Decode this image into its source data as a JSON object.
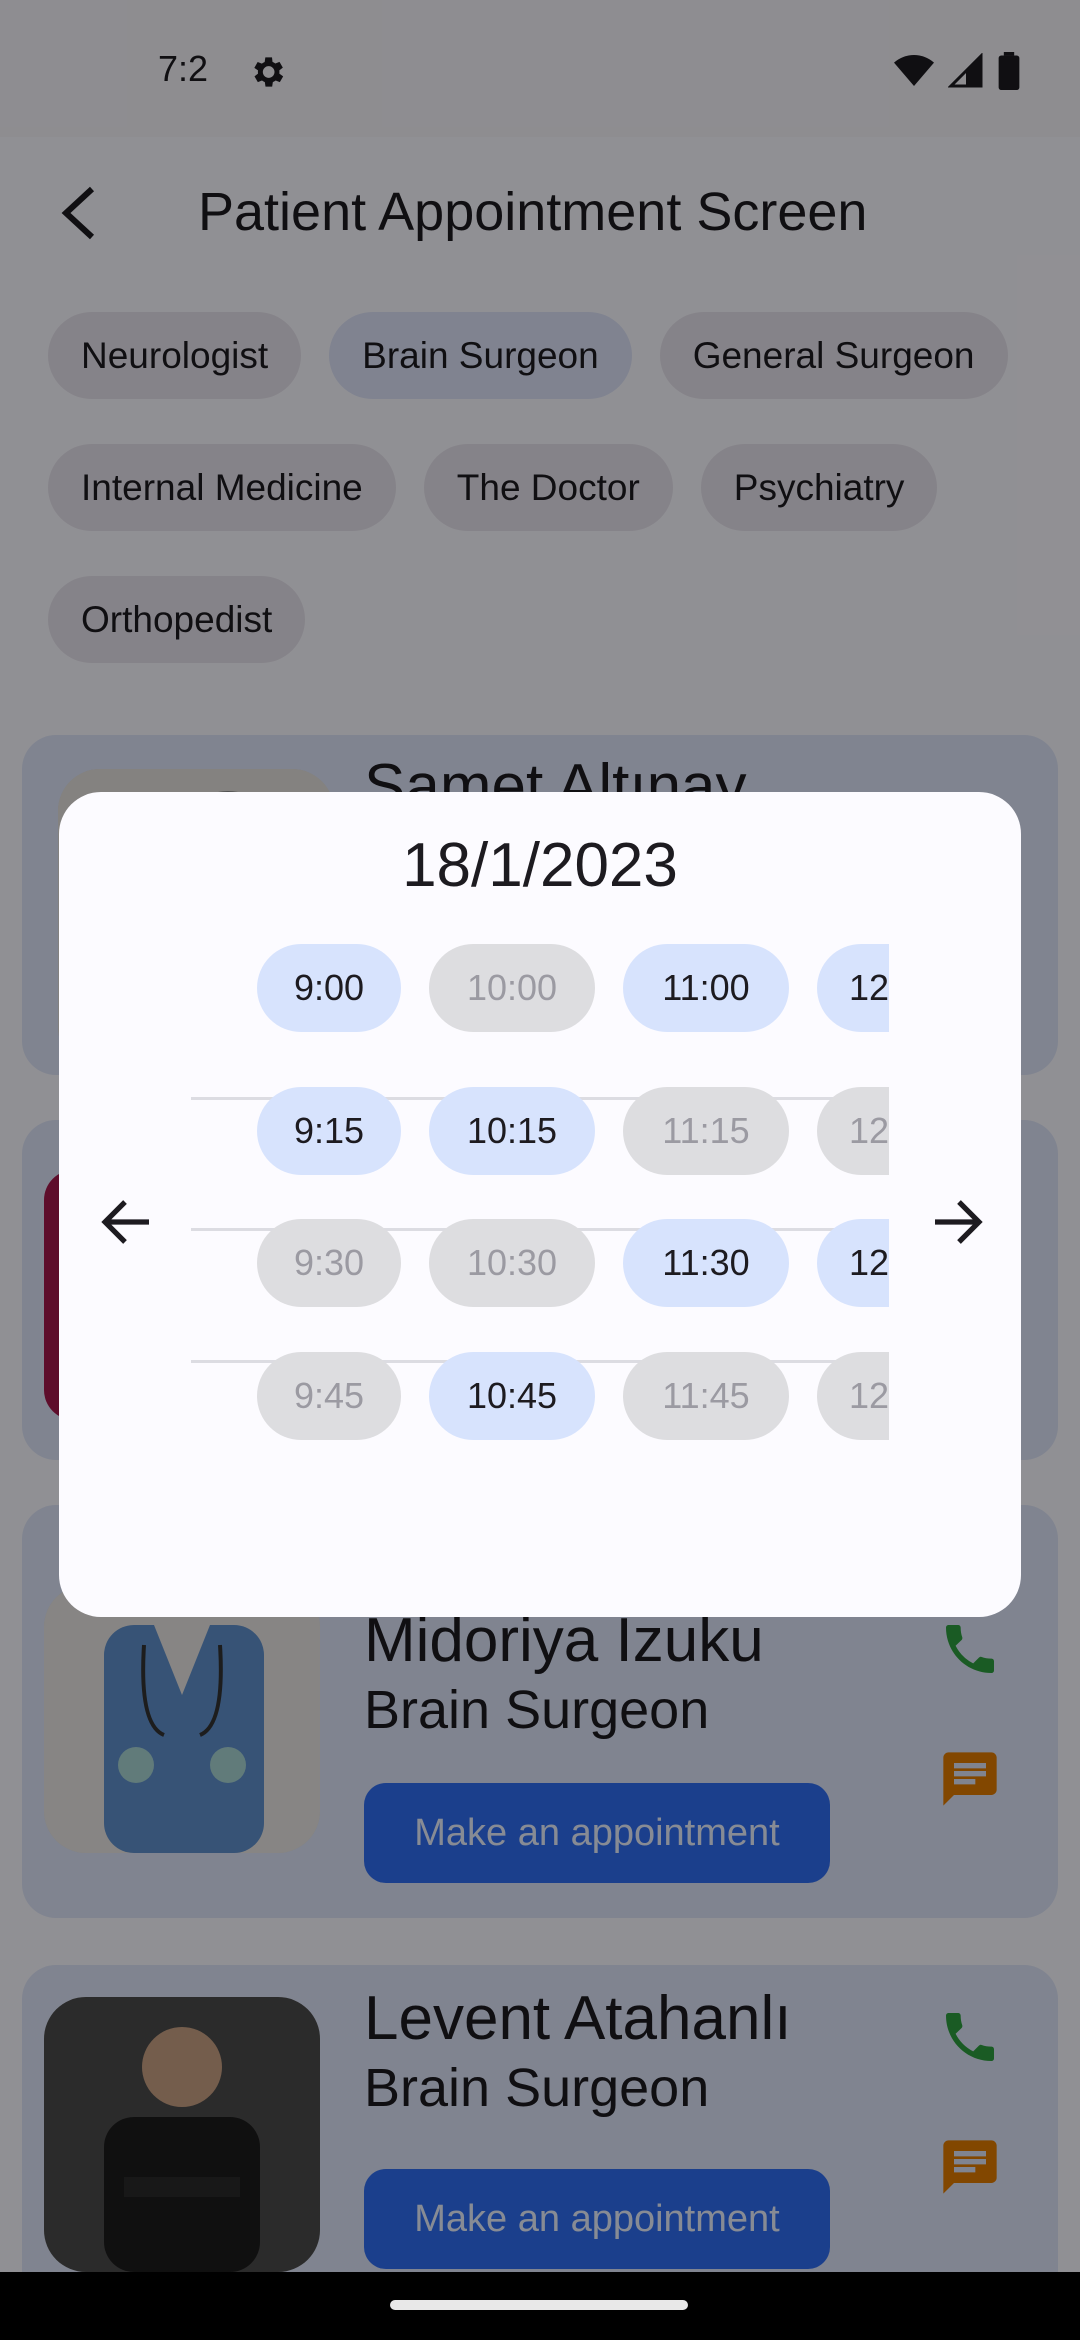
{
  "status_bar": {
    "time": "7:2"
  },
  "app_bar": {
    "title": "Patient Appointment Screen"
  },
  "chips": [
    "Neurologist",
    "Brain Surgeon",
    "General Surgeon",
    "Internal Medicine",
    "The Doctor",
    "Psychiatry",
    "Orthopedist"
  ],
  "selected_chip": "Brain Surgeon",
  "cards": [
    {
      "name": "Samet Altınay",
      "specialty": "",
      "button": ""
    },
    {
      "name": "",
      "specialty": "",
      "button": ""
    },
    {
      "name": "Midoriya Izuku",
      "specialty": "Brain Surgeon",
      "button": "Make an appointment"
    },
    {
      "name": "Levent Atahanlı",
      "specialty": "Brain Surgeon",
      "button": "Make an appointment"
    }
  ],
  "dialog": {
    "date": "18/1/2023",
    "slot_rows": [
      [
        {
          "label": "9:00",
          "available": true
        },
        {
          "label": "10:00",
          "available": false
        },
        {
          "label": "11:00",
          "available": true
        },
        {
          "label": "12",
          "available": true
        }
      ],
      [
        {
          "label": "9:15",
          "available": true
        },
        {
          "label": "10:15",
          "available": true
        },
        {
          "label": "11:15",
          "available": false
        },
        {
          "label": "12",
          "available": false
        }
      ],
      [
        {
          "label": "9:30",
          "available": false
        },
        {
          "label": "10:30",
          "available": false
        },
        {
          "label": "11:30",
          "available": true
        },
        {
          "label": "12",
          "available": true
        }
      ],
      [
        {
          "label": "9:45",
          "available": false
        },
        {
          "label": "10:45",
          "available": true
        },
        {
          "label": "11:45",
          "available": false
        },
        {
          "label": "12",
          "available": false
        }
      ]
    ]
  },
  "colors": {
    "primary": "#2f6df2",
    "slot_available": "#d7e3fd",
    "slot_taken": "#dddde0",
    "phone_icon": "#2e9e3e",
    "chat_icon": "#e07b00"
  }
}
